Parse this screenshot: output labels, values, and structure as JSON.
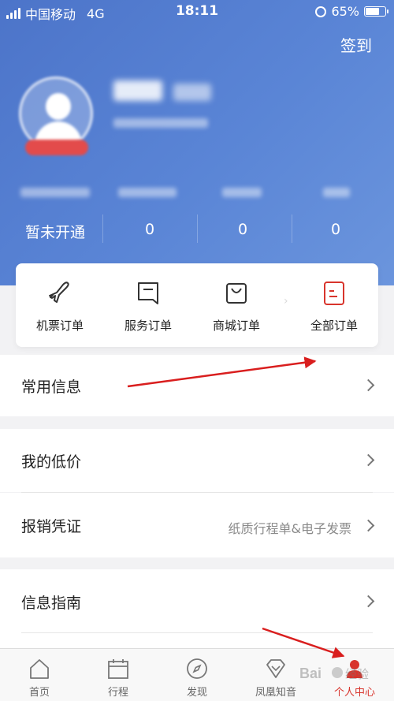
{
  "status_bar": {
    "carrier": "中国移动",
    "network": "4G",
    "time": "18:11",
    "battery": "65%"
  },
  "header": {
    "signin_label": "签到",
    "stats": [
      "暂未开通",
      "0",
      "0",
      "0"
    ]
  },
  "orders": [
    {
      "label": "机票订单",
      "icon": "plane-icon"
    },
    {
      "label": "服务订单",
      "icon": "service-icon"
    },
    {
      "label": "商城订单",
      "icon": "shopping-bag-icon"
    },
    {
      "label": "全部订单",
      "icon": "all-orders-icon"
    }
  ],
  "menu": {
    "common_info": "常用信息",
    "my_low_price": "我的低价",
    "reimbursement": "报销凭证",
    "reimbursement_sub": "纸质行程单&电子发票",
    "info_guide": "信息指南"
  },
  "tabs": [
    {
      "label": "首页",
      "icon": "home-icon"
    },
    {
      "label": "行程",
      "icon": "calendar-icon"
    },
    {
      "label": "发现",
      "icon": "compass-icon"
    },
    {
      "label": "凤凰知音",
      "icon": "diamond-icon"
    },
    {
      "label": "个人中心",
      "icon": "person-icon"
    }
  ],
  "colors": {
    "header_blue": "#5a85d6",
    "accent_red": "#d8342c",
    "annotation_arrow": "#d91e1e"
  }
}
